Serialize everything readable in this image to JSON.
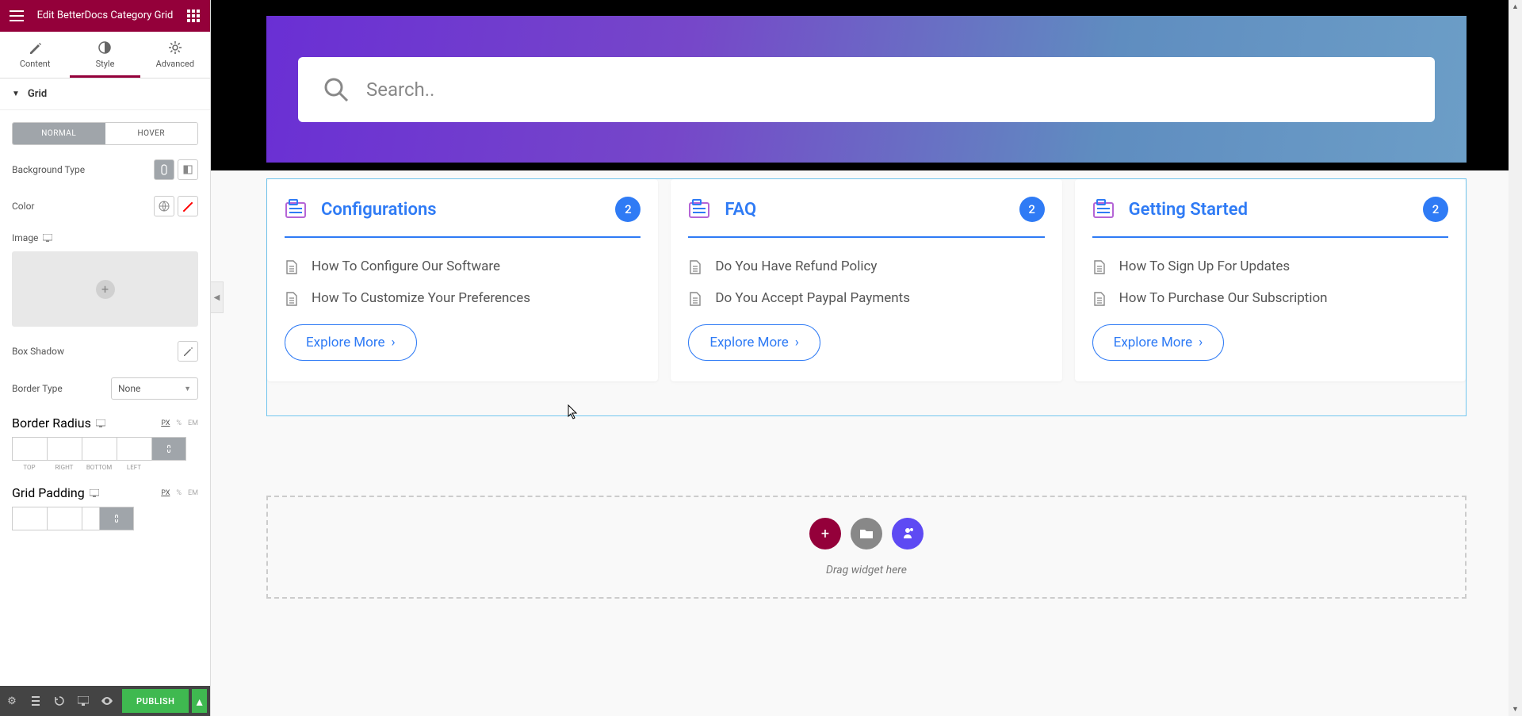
{
  "sidebar": {
    "title": "Edit BetterDocs Category Grid",
    "tabs": {
      "content": "Content",
      "style": "Style",
      "advanced": "Advanced"
    },
    "section": "Grid",
    "toggle": {
      "normal": "NORMAL",
      "hover": "HOVER"
    },
    "labels": {
      "bgtype": "Background Type",
      "color": "Color",
      "image": "Image",
      "boxshadow": "Box Shadow",
      "bordertype": "Border Type",
      "borderradius": "Border Radius",
      "gridpadding": "Grid Padding"
    },
    "bordertype_value": "None",
    "units": {
      "px": "PX",
      "pct": "%",
      "em": "EM"
    },
    "dims": {
      "top": "TOP",
      "right": "RIGHT",
      "bottom": "BOTTOM",
      "left": "LEFT"
    },
    "publish": "PUBLISH"
  },
  "preview": {
    "search_placeholder": "Search..",
    "explore": "Explore More",
    "drop_text": "Drag widget here",
    "categories": [
      {
        "title": "Configurations",
        "count": "2",
        "docs": [
          "How To Configure Our Software",
          "How To Customize Your Preferences"
        ]
      },
      {
        "title": "FAQ",
        "count": "2",
        "docs": [
          "Do You Have Refund Policy",
          "Do You Accept Paypal Payments"
        ]
      },
      {
        "title": "Getting Started",
        "count": "2",
        "docs": [
          "How To Sign Up For Updates",
          "How To Purchase Our Subscription"
        ]
      }
    ]
  }
}
